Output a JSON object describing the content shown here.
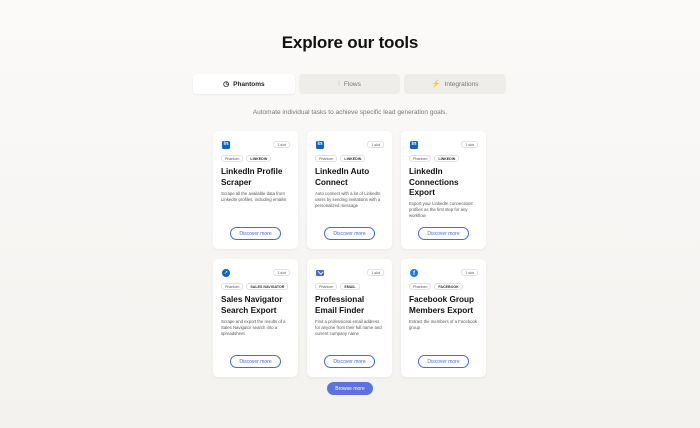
{
  "page": {
    "title": "Explore our tools",
    "subtitle": "Automate individual tasks to achieve specific lead generation goals."
  },
  "tabs": [
    {
      "label": "Phantoms",
      "icon": "phantom-icon",
      "active": true
    },
    {
      "label": "Flows",
      "icon": "flows-icon",
      "active": false
    },
    {
      "label": "Integrations",
      "icon": "integrations-icon",
      "active": false
    }
  ],
  "cards": [
    {
      "icon": "linkedin-icon",
      "slot": "1 slot",
      "tags": [
        "Phantom",
        "LINKEDIN"
      ],
      "title": "LinkedIn Profile Scraper",
      "desc": "Scrape all the available data from LinkedIn profiles, including emails!",
      "cta": "Discover more"
    },
    {
      "icon": "linkedin-icon",
      "slot": "1 slot",
      "tags": [
        "Phantom",
        "LINKEDIN"
      ],
      "title": "LinkedIn Auto Connect",
      "desc": "Auto connect with a lot of LinkedIn users by sending invitations with a personalized message",
      "cta": "Discover more"
    },
    {
      "icon": "linkedin-icon",
      "slot": "1 slot",
      "tags": [
        "Phantom",
        "LINKEDIN"
      ],
      "title": "LinkedIn Connections Export",
      "desc": "Export your LinkedIn connections' profiles as the first step for any workflow",
      "cta": "Discover more"
    },
    {
      "icon": "sales-navigator-icon",
      "slot": "1 slot",
      "tags": [
        "Phantom",
        "SALES NAVIGATOR"
      ],
      "title": "Sales Navigator Search Export",
      "desc": "Scrape and export the results of a Sales Navigator search into a spreadsheet",
      "cta": "Discover more"
    },
    {
      "icon": "email-icon",
      "slot": "1 slot",
      "tags": [
        "Phantom",
        "EMAIL"
      ],
      "title": "Professional Email Finder",
      "desc": "Find a professional email address for anyone from their full name and current company name",
      "cta": "Discover more"
    },
    {
      "icon": "facebook-icon",
      "slot": "1 slot",
      "tags": [
        "Phantom",
        "FACEBOOK"
      ],
      "title": "Facebook Group Members Export",
      "desc": "Extract the members of a Facebook group",
      "cta": "Discover more"
    }
  ],
  "browse_label": "Browse more",
  "colors": {
    "accent": "#4a68d9",
    "button": "#5b73dc",
    "linkedin": "#0a66c2",
    "facebook": "#1877f2"
  }
}
